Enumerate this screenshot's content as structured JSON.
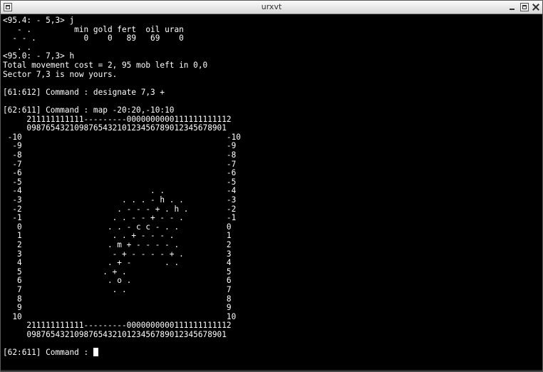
{
  "window": {
    "title": "urxvt",
    "icons": [
      "window-menu-icon",
      "minimize-icon",
      "maximize-icon",
      "close-icon"
    ]
  },
  "terminal": {
    "foreground": "#ffffff",
    "background": "#000000",
    "lines": [
      "<95.4: - 5,3> j",
      "   - .         min gold fert  oil uran",
      "  - - .          0    0   89   69    0",
      "   . .",
      "<95.0: - 7,3> h",
      "Total movement cost = 2, 95 mob left in 0,0",
      "Sector 7,3 is now yours.",
      "",
      "[61:612] Command : designate 7,3 +",
      "",
      "[62:611] Command : map -20:20,-10:10",
      "     211111111111---------0000000000111111111112",
      "     098765432109876543210123456789012345678901",
      " -10                                           -10",
      "  -9                                           -9",
      "  -8                                           -8",
      "  -7                                           -7",
      "  -6                                           -6",
      "  -5                                           -5",
      "  -4                           . .             -4",
      "  -3                     . . . - h . .         -3",
      "  -2                    . - - - + . h .        -2",
      "  -1                   . . - - + - - .         -1",
      "   0                  . . - c c - . .          0",
      "   1                   . . + - - - .           1",
      "   2                  . m + - - - - .          2",
      "   3                   - + - - - - + .         3",
      "   4                  . + -       . .          4",
      "   5                 . + .                     5",
      "   6                  . o .                    6",
      "   7                   . .                     7",
      "   8                                           8",
      "   9                                           9",
      "  10                                           10",
      "     211111111111---------0000000000111111111112",
      "     098765432109876543210123456789012345678901",
      "",
      "[62:611] Command : "
    ]
  }
}
